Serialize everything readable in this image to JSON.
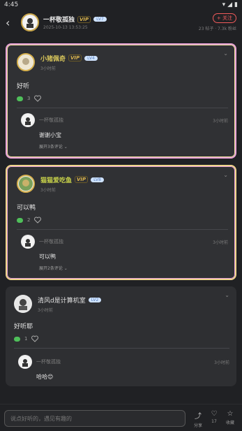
{
  "status_bar": {
    "time": "4:45"
  },
  "header": {
    "name": "一杯敬孤独",
    "vip": "VIP",
    "level": "LV7",
    "date": "2025-10-13 13:53:25",
    "follow": "+ 关注",
    "stats": "23 帖子 · 7.3k 粉丝"
  },
  "comments": [
    {
      "name": "小猪佩奇",
      "vip": "VIP",
      "level": "LV4",
      "time": "3小时前",
      "text": "好听",
      "reply_count": "3",
      "reply": {
        "name": "一杯敬孤独",
        "time": "3小时前",
        "text": "谢谢小宝",
        "more": "展开3条评论"
      }
    },
    {
      "name": "猫猫爱吃鱼",
      "vip": "VIP",
      "level": "LV8",
      "time": "3小时前",
      "text": "可以鸭",
      "reply_count": "2",
      "reply": {
        "name": "一杯敬孤独",
        "time": "3小时前",
        "text": "可以鸭",
        "more": "展开2条评论"
      }
    },
    {
      "name": "清风d是计算机室",
      "level": "LV2",
      "time": "3小时前",
      "text": "好听耶",
      "reply_count": "1",
      "reply": {
        "name": "一杯敬孤独",
        "time": "3小时前",
        "text": "哈哈😊"
      }
    }
  ],
  "bottom": {
    "placeholder": "说点好听的，遇见有趣的",
    "share": "分享",
    "likes": "17",
    "collect": "收藏"
  }
}
